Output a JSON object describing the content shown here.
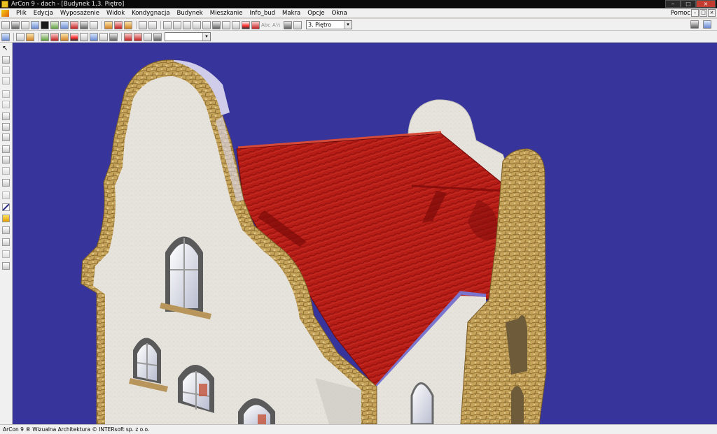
{
  "window": {
    "title": "ArCon 9 - dach - [Budynek 1,3. Piętro]",
    "buttons": [
      "–",
      "□",
      "×"
    ]
  },
  "menubar": {
    "items": [
      "Plik",
      "Edycja",
      "Wyposażenie",
      "Widok",
      "Kondygnacja",
      "Budynek",
      "Mieszkanie",
      "Info_bud",
      "Makra",
      "Opcje",
      "Okna"
    ],
    "help": "Pomoc",
    "mdi_buttons": [
      "–",
      "□",
      "×"
    ]
  },
  "toolbar": {
    "floor_select": {
      "value": "3. Piętro"
    },
    "text_tool_label": "Abc",
    "text_tool_sub": "A½"
  },
  "toolbar2": {
    "combo_value": ""
  },
  "statusbar": {
    "text": "ArCon 9 ® Wizualna Architektura © INTERsoft sp. z o.o."
  },
  "viewport": {
    "background_color": "#37349b",
    "roof_color": "#b51f18",
    "facade_color": "#e5e2dc",
    "stone_trim_color": "#c7a55a",
    "gutter_color": "#7a76cf"
  }
}
